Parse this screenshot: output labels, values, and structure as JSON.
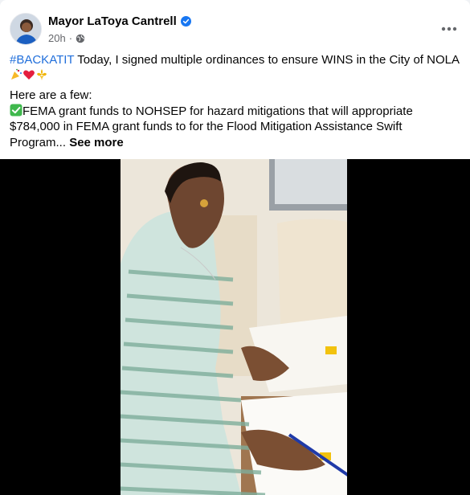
{
  "post": {
    "author_name": "Mayor LaToya Cantrell",
    "timestamp": "20h",
    "separator": "·",
    "hashtag": "#BACKATIT",
    "line1_text": " Today, I signed multiple ordinances to ensure WINS in the City of NOLA",
    "line2_text": "Here are a few:",
    "line3_text": "FEMA grant funds to NOHSEP for hazard mitigations that will appropriate $784,000 in FEMA grant funds to for the Flood Mitigation Assistance Swift Program...",
    "see_more": "See more"
  },
  "icons": {
    "verified": "verified-badge-icon",
    "privacy": "globe-icon",
    "more": "more-options-icon",
    "emojis": [
      "party-popper-icon",
      "red-heart-icon",
      "fleur-de-lis-icon",
      "check-mark-button-icon"
    ]
  },
  "colors": {
    "hashtag": "#216fdb",
    "verified": "#1877f2",
    "meta_text": "#65676b",
    "video_letterbox": "#000000"
  }
}
